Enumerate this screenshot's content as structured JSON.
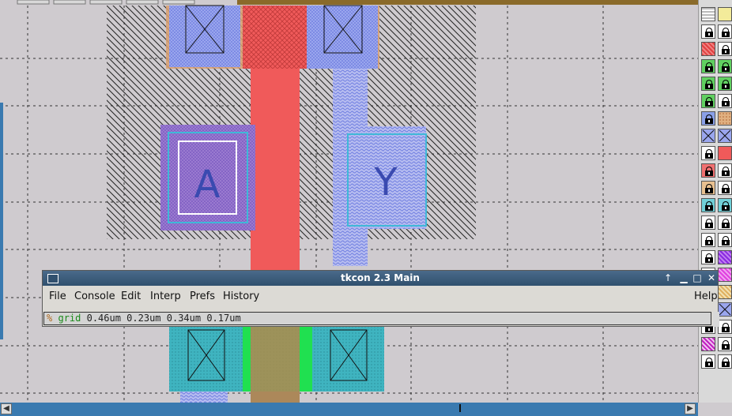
{
  "layout": {
    "labels": {
      "input_a": "A",
      "output_y": "Y"
    }
  },
  "palette": {
    "rows": [
      [
        "grid-swatch",
        "yellow-swatch"
      ],
      [
        "lock-icon",
        "lock-icon"
      ],
      [
        "red-hatch-swatch",
        "lock-icon"
      ],
      [
        "lock-icon-green",
        "lock-icon-green"
      ],
      [
        "lock-icon-green",
        "lock-icon-green"
      ],
      [
        "lock-icon-green",
        "lock-icon"
      ],
      [
        "lock-icon-blue",
        "orange-dot-swatch"
      ],
      [
        "contact-x-swatch",
        "contact-x-swatch"
      ],
      [
        "lock-icon",
        "red-swatch"
      ],
      [
        "lock-icon-red",
        "lock-icon"
      ],
      [
        "lock-icon-orange",
        "lock-icon"
      ],
      [
        "lock-icon-cyan",
        "lock-icon-cyan"
      ],
      [
        "lock-icon",
        "lock-icon"
      ],
      [
        "lock-icon",
        "lock-icon"
      ],
      [
        "lock-icon",
        "purple-hatch-swatch"
      ],
      [
        "lock-icon",
        "magenta-swatch"
      ],
      [
        "lock-icon",
        "cross-hatch-swatch"
      ],
      [
        "lock-icon",
        "contact-x-swatch"
      ],
      [
        "lock-icon",
        "lock-icon"
      ],
      [
        "magenta-hatch-swatch",
        "lock-icon"
      ],
      [
        "lock-icon",
        "lock-icon"
      ]
    ]
  },
  "tkcon": {
    "title": "tkcon 2.3 Main",
    "menu": {
      "file": "File",
      "console": "Console",
      "edit": "Edit",
      "interp": "Interp",
      "prefs": "Prefs",
      "history": "History",
      "help": "Help"
    },
    "prompt": "%",
    "command": "grid",
    "args": " 0.46um 0.23um 0.34um 0.17um"
  }
}
